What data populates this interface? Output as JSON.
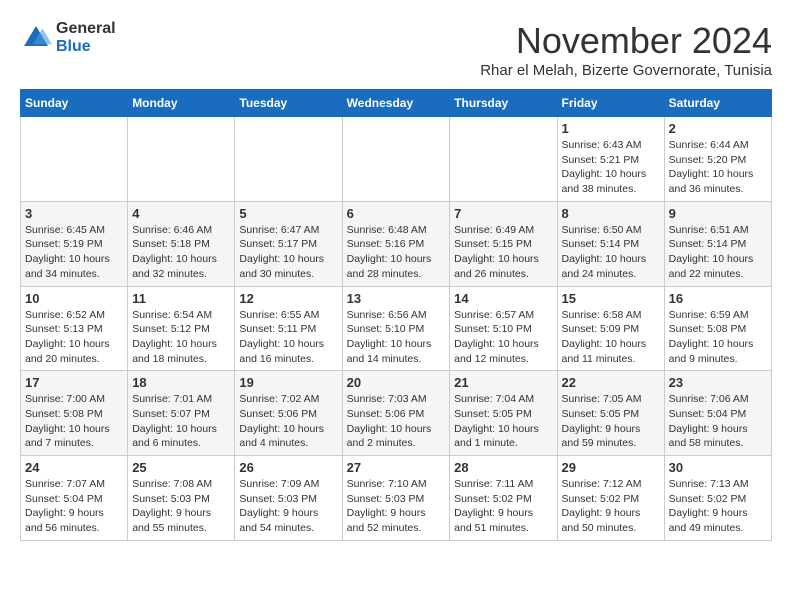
{
  "header": {
    "logo_general": "General",
    "logo_blue": "Blue",
    "month_title": "November 2024",
    "subtitle": "Rhar el Melah, Bizerte Governorate, Tunisia"
  },
  "weekdays": [
    "Sunday",
    "Monday",
    "Tuesday",
    "Wednesday",
    "Thursday",
    "Friday",
    "Saturday"
  ],
  "weeks": [
    [
      {
        "day": "",
        "info": ""
      },
      {
        "day": "",
        "info": ""
      },
      {
        "day": "",
        "info": ""
      },
      {
        "day": "",
        "info": ""
      },
      {
        "day": "",
        "info": ""
      },
      {
        "day": "1",
        "info": "Sunrise: 6:43 AM\nSunset: 5:21 PM\nDaylight: 10 hours\nand 38 minutes."
      },
      {
        "day": "2",
        "info": "Sunrise: 6:44 AM\nSunset: 5:20 PM\nDaylight: 10 hours\nand 36 minutes."
      }
    ],
    [
      {
        "day": "3",
        "info": "Sunrise: 6:45 AM\nSunset: 5:19 PM\nDaylight: 10 hours\nand 34 minutes."
      },
      {
        "day": "4",
        "info": "Sunrise: 6:46 AM\nSunset: 5:18 PM\nDaylight: 10 hours\nand 32 minutes."
      },
      {
        "day": "5",
        "info": "Sunrise: 6:47 AM\nSunset: 5:17 PM\nDaylight: 10 hours\nand 30 minutes."
      },
      {
        "day": "6",
        "info": "Sunrise: 6:48 AM\nSunset: 5:16 PM\nDaylight: 10 hours\nand 28 minutes."
      },
      {
        "day": "7",
        "info": "Sunrise: 6:49 AM\nSunset: 5:15 PM\nDaylight: 10 hours\nand 26 minutes."
      },
      {
        "day": "8",
        "info": "Sunrise: 6:50 AM\nSunset: 5:14 PM\nDaylight: 10 hours\nand 24 minutes."
      },
      {
        "day": "9",
        "info": "Sunrise: 6:51 AM\nSunset: 5:14 PM\nDaylight: 10 hours\nand 22 minutes."
      }
    ],
    [
      {
        "day": "10",
        "info": "Sunrise: 6:52 AM\nSunset: 5:13 PM\nDaylight: 10 hours\nand 20 minutes."
      },
      {
        "day": "11",
        "info": "Sunrise: 6:54 AM\nSunset: 5:12 PM\nDaylight: 10 hours\nand 18 minutes."
      },
      {
        "day": "12",
        "info": "Sunrise: 6:55 AM\nSunset: 5:11 PM\nDaylight: 10 hours\nand 16 minutes."
      },
      {
        "day": "13",
        "info": "Sunrise: 6:56 AM\nSunset: 5:10 PM\nDaylight: 10 hours\nand 14 minutes."
      },
      {
        "day": "14",
        "info": "Sunrise: 6:57 AM\nSunset: 5:10 PM\nDaylight: 10 hours\nand 12 minutes."
      },
      {
        "day": "15",
        "info": "Sunrise: 6:58 AM\nSunset: 5:09 PM\nDaylight: 10 hours\nand 11 minutes."
      },
      {
        "day": "16",
        "info": "Sunrise: 6:59 AM\nSunset: 5:08 PM\nDaylight: 10 hours\nand 9 minutes."
      }
    ],
    [
      {
        "day": "17",
        "info": "Sunrise: 7:00 AM\nSunset: 5:08 PM\nDaylight: 10 hours\nand 7 minutes."
      },
      {
        "day": "18",
        "info": "Sunrise: 7:01 AM\nSunset: 5:07 PM\nDaylight: 10 hours\nand 6 minutes."
      },
      {
        "day": "19",
        "info": "Sunrise: 7:02 AM\nSunset: 5:06 PM\nDaylight: 10 hours\nand 4 minutes."
      },
      {
        "day": "20",
        "info": "Sunrise: 7:03 AM\nSunset: 5:06 PM\nDaylight: 10 hours\nand 2 minutes."
      },
      {
        "day": "21",
        "info": "Sunrise: 7:04 AM\nSunset: 5:05 PM\nDaylight: 10 hours\nand 1 minute."
      },
      {
        "day": "22",
        "info": "Sunrise: 7:05 AM\nSunset: 5:05 PM\nDaylight: 9 hours\nand 59 minutes."
      },
      {
        "day": "23",
        "info": "Sunrise: 7:06 AM\nSunset: 5:04 PM\nDaylight: 9 hours\nand 58 minutes."
      }
    ],
    [
      {
        "day": "24",
        "info": "Sunrise: 7:07 AM\nSunset: 5:04 PM\nDaylight: 9 hours\nand 56 minutes."
      },
      {
        "day": "25",
        "info": "Sunrise: 7:08 AM\nSunset: 5:03 PM\nDaylight: 9 hours\nand 55 minutes."
      },
      {
        "day": "26",
        "info": "Sunrise: 7:09 AM\nSunset: 5:03 PM\nDaylight: 9 hours\nand 54 minutes."
      },
      {
        "day": "27",
        "info": "Sunrise: 7:10 AM\nSunset: 5:03 PM\nDaylight: 9 hours\nand 52 minutes."
      },
      {
        "day": "28",
        "info": "Sunrise: 7:11 AM\nSunset: 5:02 PM\nDaylight: 9 hours\nand 51 minutes."
      },
      {
        "day": "29",
        "info": "Sunrise: 7:12 AM\nSunset: 5:02 PM\nDaylight: 9 hours\nand 50 minutes."
      },
      {
        "day": "30",
        "info": "Sunrise: 7:13 AM\nSunset: 5:02 PM\nDaylight: 9 hours\nand 49 minutes."
      }
    ]
  ]
}
